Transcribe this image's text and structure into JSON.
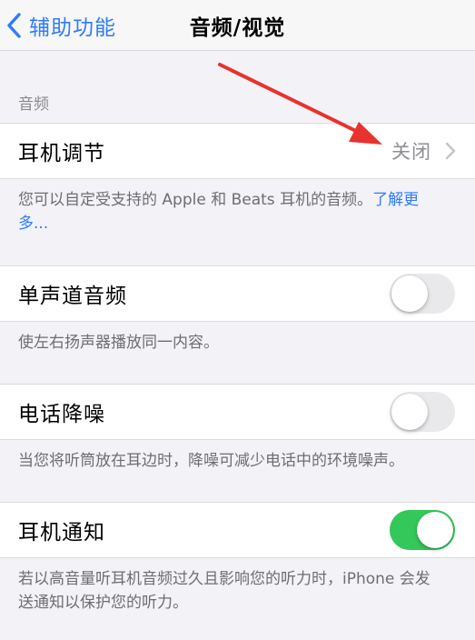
{
  "nav": {
    "back_label": "辅助功能",
    "title": "音频/视觉"
  },
  "audio_section": {
    "header": "音频"
  },
  "headphone_accommodations": {
    "label": "耳机调节",
    "value": "关闭",
    "footer_text": "您可以自定受支持的 Apple 和 Beats 耳机的音频。",
    "footer_link": "了解更多..."
  },
  "mono_audio": {
    "label": "单声道音频",
    "enabled": false,
    "footer": "使左右扬声器播放同一内容。"
  },
  "phone_noise_cancellation": {
    "label": "电话降噪",
    "enabled": false,
    "footer": "当您将听筒放在耳边时，降噪可减少电话中的环境噪声。"
  },
  "headphone_notifications": {
    "label": "耳机通知",
    "enabled": true,
    "footer": "若以高音量听耳机音频过久且影响您的听力时，iPhone 会发送通知以保护您的听力。"
  },
  "colors": {
    "accent": "#2f7cf6",
    "toggle_on": "#34c759",
    "annotation_arrow": "#e8322e"
  }
}
